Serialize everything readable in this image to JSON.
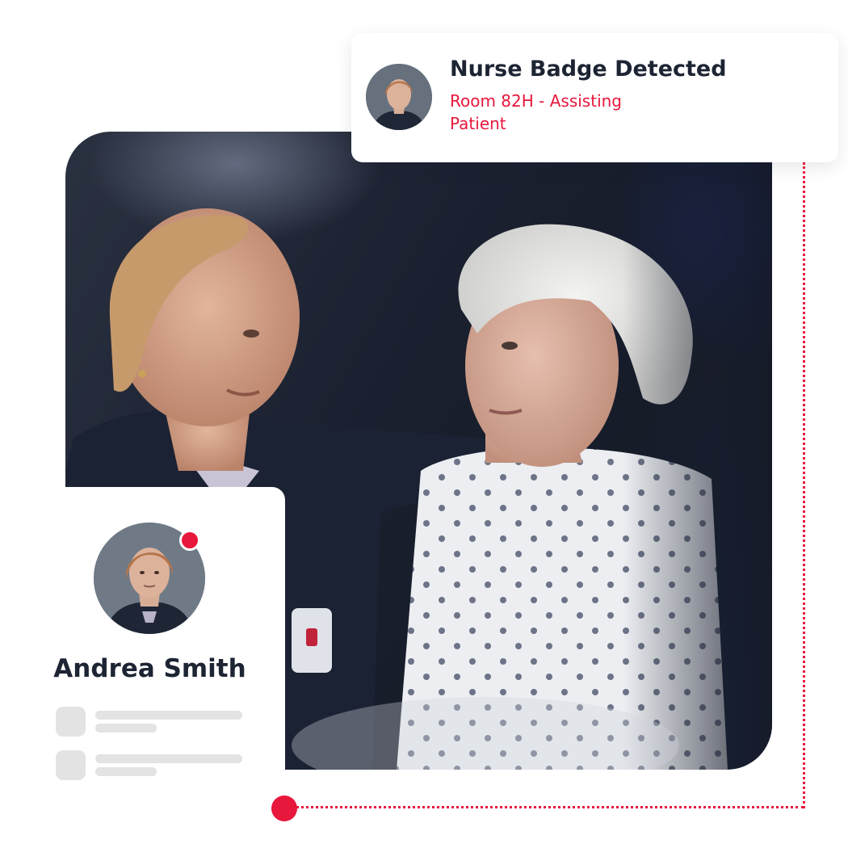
{
  "notification": {
    "title": "Nurse Badge Detected",
    "subtitle": "Room 82H - Assisting Patient"
  },
  "profile": {
    "name": "Andrea Smith",
    "status": "active"
  },
  "colors": {
    "accent": "#e8173c",
    "text_dark": "#1d2433",
    "placeholder": "#e3e3e3"
  },
  "icons": {
    "avatar": "nurse-portrait",
    "status": "red-dot"
  }
}
